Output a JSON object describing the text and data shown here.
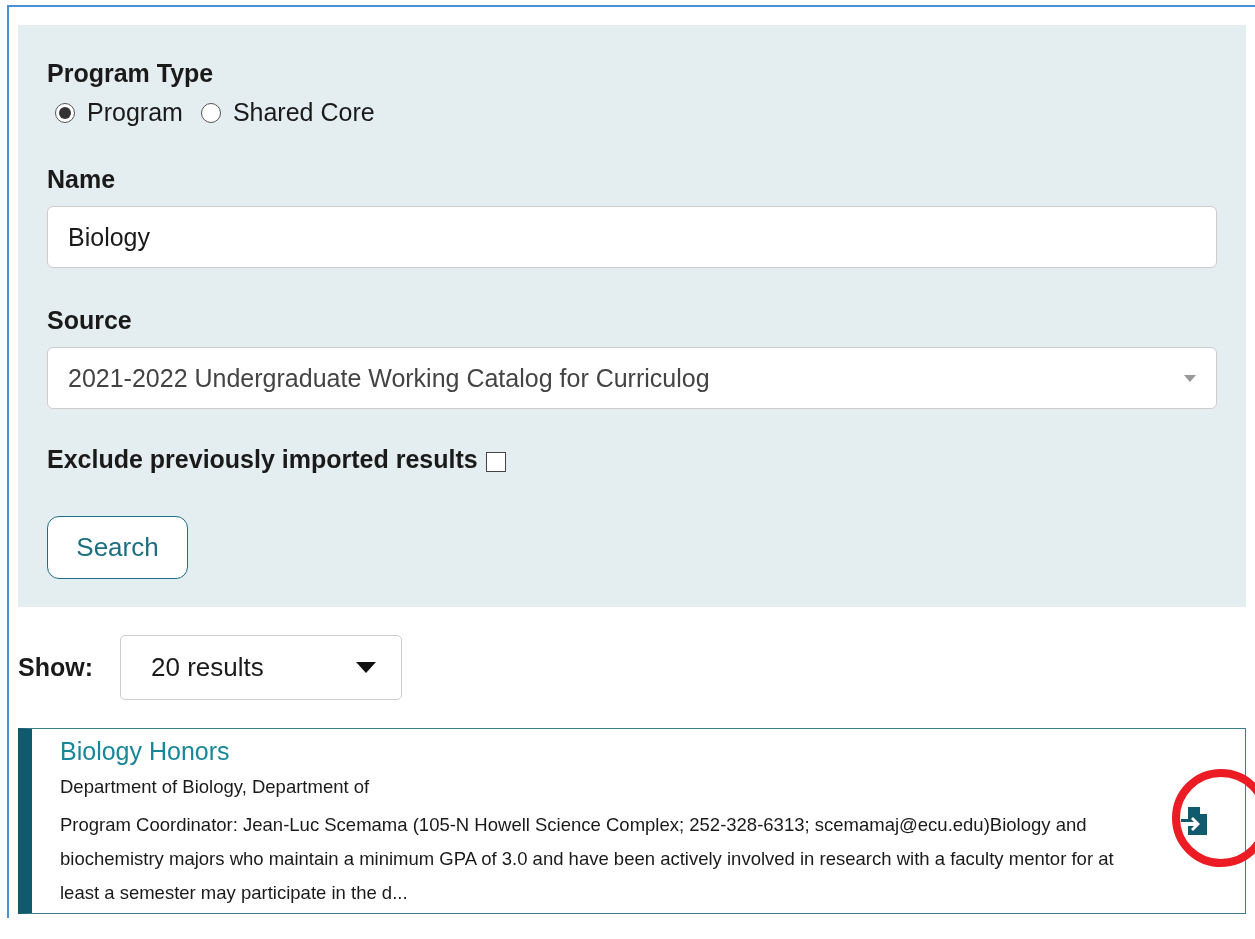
{
  "filter": {
    "program_type": {
      "label": "Program Type",
      "options": [
        {
          "label": "Program",
          "selected": true
        },
        {
          "label": "Shared Core",
          "selected": false
        }
      ]
    },
    "name": {
      "label": "Name",
      "value": "Biology"
    },
    "source": {
      "label": "Source",
      "value": "2021-2022 Undergraduate Working Catalog for Curriculog"
    },
    "exclude": {
      "label": "Exclude previously imported results",
      "checked": false
    },
    "search_button": "Search"
  },
  "show": {
    "label": "Show:",
    "value": "20 results"
  },
  "results": [
    {
      "title": "Biology Honors",
      "department": "Department of Biology, Department of",
      "description": "Program Coordinator: Jean-Luc Scemama (105-N Howell Science Complex; 252-328-6313; scemamaj@ecu.edu)Biology and biochemistry majors who maintain a minimum GPA of 3.0 and have been actively involved in research with a faculty mentor for at least a semester may participate in the d...",
      "highlighted": true
    }
  ]
}
